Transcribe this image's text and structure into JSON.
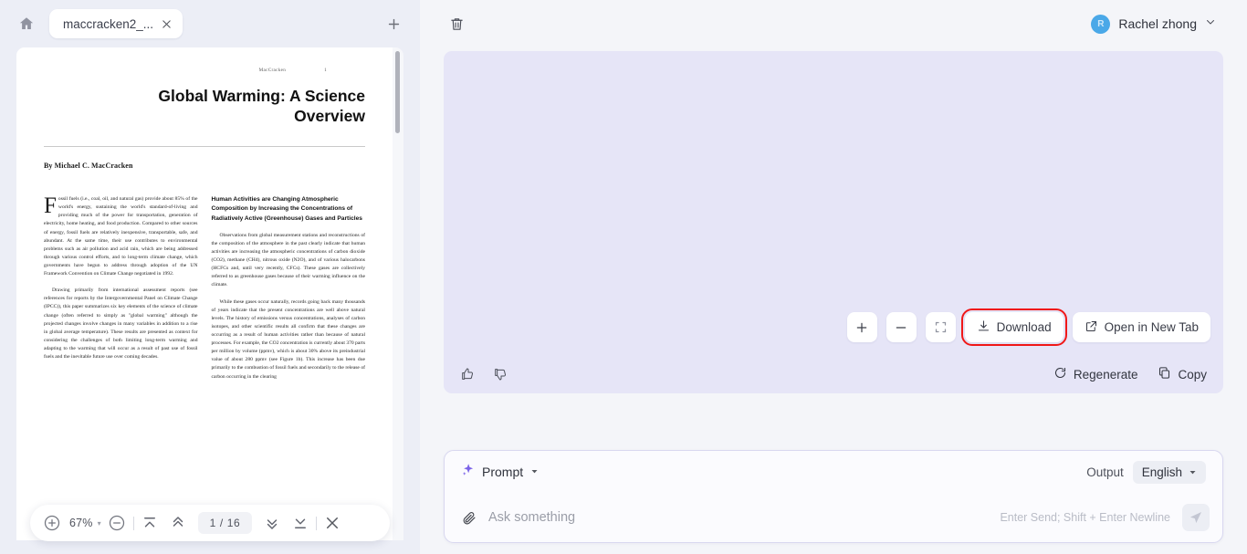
{
  "left_pane": {
    "home_icon": "home-icon",
    "tab": {
      "name": "maccracken2_...",
      "close_icon": "close-icon"
    },
    "new_tab_icon": "plus-icon",
    "document": {
      "running_head": "MacCracken",
      "running_page": "1",
      "title": "Global Warming: A Science Overview",
      "author": "By Michael C. MacCracken",
      "left_column": {
        "paragraphs": [
          "Fossil fuels (i.e., coal, oil, and natural gas) provide about 85% of the world's energy, sustaining the world's standard-of-living and providing much of the power for transportation, generation of electricity, home heating, and food production. Compared to other sources of energy, fossil fuels are relatively inexpensive, transportable, safe, and abundant. At the same time, their use contributes to environmental problems such as air pollution and acid rain, which are being addressed through various control efforts, and to long-term climate change, which governments have begun to address through adoption of the UN Framework Convention on Climate Change negotiated in 1992.",
          "Drawing primarily from international assessment reports (see references for reports by the Intergovernmental Panel on Climate Change (IPCC)), this paper summarizes six key elements of the science of climate change (often referred to simply as \"global warming\" although the projected changes involve changes in many variables in addition to a rise in global average temperature). These results are presented as context for considering the challenges of both limiting long-term warming and adapting to the warming that will occur as a result of past use of fossil fuels and the inevitable future use over coming decades."
        ]
      },
      "right_column": {
        "heading": "Human Activities are Changing Atmospheric Composition by Increasing the Concentrations of Radiatively Active (Greenhouse) Gases and Particles",
        "paragraphs": [
          "Observations from global measurement stations and reconstructions of the composition of the atmosphere in the past clearly indicate that human activities are increasing the atmospheric concentrations of carbon dioxide (CO2), methane (CH4), nitrous oxide (N2O), and of various halocarbons (HCFCs and, until very recently, CFCs). These gases are collectively referred to as greenhouse gases because of their warming influence on the climate.",
          "While these gases occur naturally, records going back many thousands of years indicate that the present concentrations are well above natural levels. The history of emissions versus concentrations, analyses of carbon isotopes, and other scientific results all confirm that these changes are occurring as a result of human activities rather than because of natural processes. For example, the CO2 concentration is currently about 370 parts per million by volume (ppmv), which is about 30% above its preindustrial value of about 280 ppmv (see Figure 1b). This increase has been due primarily to the combustion of fossil fuels and secondarily to the release of carbon occurring in the clearing"
        ]
      }
    },
    "toolbar": {
      "zoom_in_icon": "zoom-in-icon",
      "zoom_level": "67%",
      "zoom_dropdown_icon": "chevron-down-icon",
      "zoom_out_icon": "zoom-out-icon",
      "first_page_icon": "first-page-icon",
      "prev_page_icon": "prev-page-icon",
      "page_indicator": "1 / 16",
      "next_page_icon": "next-page-icon",
      "last_page_icon": "last-page-icon",
      "close_icon": "close-icon"
    }
  },
  "right_pane": {
    "delete_icon": "trash-icon",
    "user": {
      "initial": "R",
      "name": "Rachel zhong",
      "dropdown_icon": "chevron-down-icon"
    },
    "preview_actions": {
      "zoom_in_icon": "plus-icon",
      "zoom_out_icon": "minus-icon",
      "fullscreen_icon": "fullscreen-icon",
      "download_label": "Download",
      "download_icon": "download-icon",
      "open_new_tab_label": "Open in New Tab",
      "open_new_tab_icon": "external-link-icon",
      "highlight_color": "#f01818"
    },
    "feedback": {
      "thumbs_up_icon": "thumbs-up-icon",
      "thumbs_down_icon": "thumbs-down-icon",
      "regenerate_label": "Regenerate",
      "regenerate_icon": "refresh-icon",
      "copy_label": "Copy",
      "copy_icon": "copy-icon"
    },
    "composer": {
      "sparkle_icon": "sparkle-icon",
      "prompt_label": "Prompt",
      "prompt_caret_icon": "chevron-down-icon",
      "output_label": "Output",
      "language_value": "English",
      "language_caret_icon": "chevron-down-icon",
      "attach_icon": "paperclip-icon",
      "input_value": "",
      "input_placeholder": "Ask something",
      "hint": "Enter Send; Shift + Enter Newline",
      "send_icon": "send-icon"
    }
  }
}
